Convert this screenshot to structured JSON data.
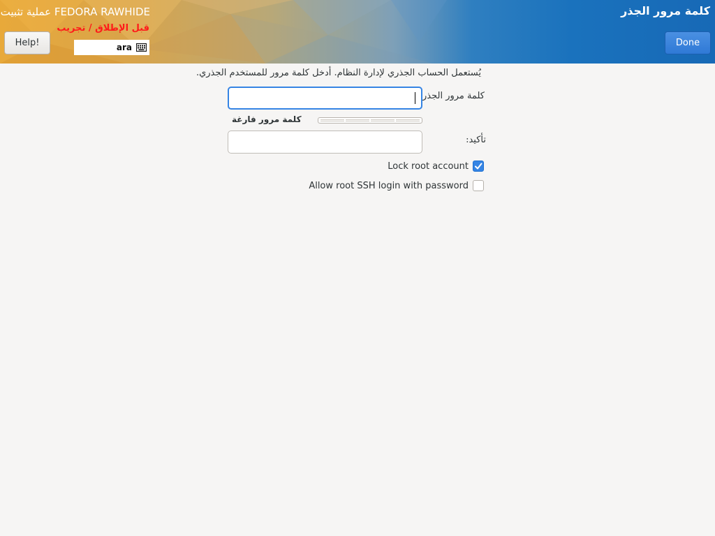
{
  "header": {
    "product_title": "عملية تثبيت FEDORA RAWHIDE",
    "prerelease_warning": "قبل الإطلاق / تجريب",
    "help_label": "Help!",
    "keyboard_layout": "ara",
    "spoke_title": "كلمة مرور الجذر",
    "done_label": "Done"
  },
  "content": {
    "description": "يُستعمل الحساب الجذري لإدارة النظام. أدخل كلمة مرور للمستخدم الجذري.",
    "password_label": "كلمة مرور الجذر:",
    "password_value": "",
    "strength_label": "كلمة مرور فارغة",
    "strength_level": 0,
    "confirm_label": "تأكيد:",
    "confirm_value": "",
    "lock_root_label": "Lock root account",
    "lock_root_checked": true,
    "ssh_login_label": "Allow root SSH login with password",
    "ssh_login_checked": false
  },
  "colors": {
    "accent": "#3584e4",
    "warning_text": "#ff1a1a",
    "header_blue": "#1769b6",
    "header_gold": "#e8a93a"
  },
  "icons": {
    "keyboard": "keyboard-icon",
    "check": "checkmark-icon"
  }
}
